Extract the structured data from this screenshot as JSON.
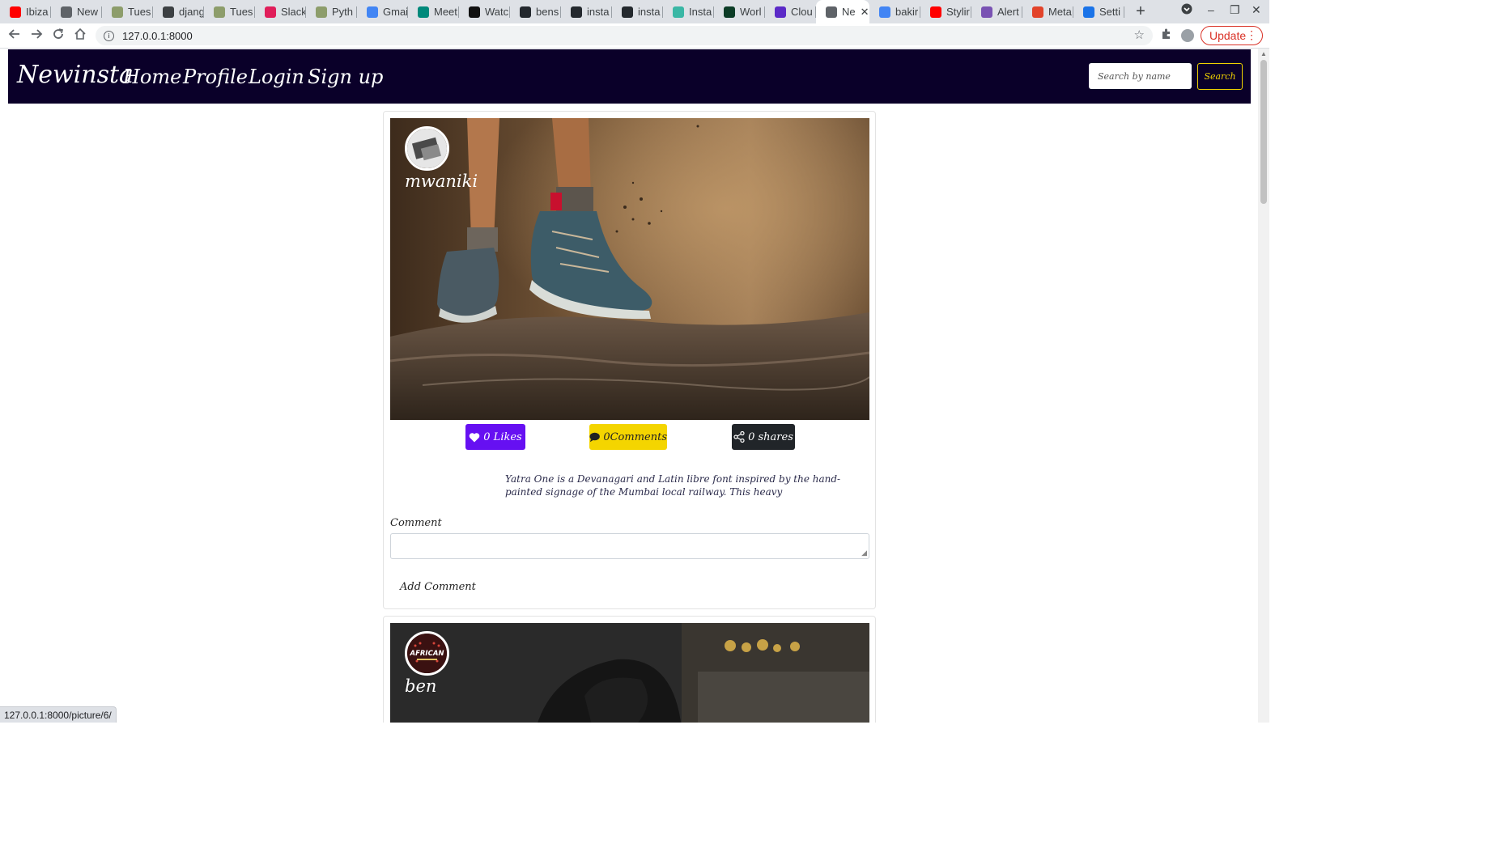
{
  "browser": {
    "tabs": [
      {
        "label": "Ibiza",
        "icon": "youtube-icon",
        "color": "#ff0000"
      },
      {
        "label": "New",
        "icon": "globe-icon",
        "color": "#5f6368"
      },
      {
        "label": "Tues",
        "icon": "tree-icon",
        "color": "#8d9d6b"
      },
      {
        "label": "djang",
        "icon": "doc-icon",
        "color": "#3c4043"
      },
      {
        "label": "Tues",
        "icon": "tree-icon",
        "color": "#8d9d6b"
      },
      {
        "label": "Slack",
        "icon": "slack-icon",
        "color": "#e01e5a"
      },
      {
        "label": "Pyth",
        "icon": "tree-icon",
        "color": "#8d9d6b"
      },
      {
        "label": "Gmai",
        "icon": "google-icon",
        "color": "#4285f4"
      },
      {
        "label": "Meet",
        "icon": "meet-icon",
        "color": "#00897b"
      },
      {
        "label": "Watc",
        "icon": "s-icon",
        "color": "#111111"
      },
      {
        "label": "bens",
        "icon": "github-icon",
        "color": "#24292e"
      },
      {
        "label": "insta",
        "icon": "github-icon",
        "color": "#24292e"
      },
      {
        "label": "insta",
        "icon": "github-icon",
        "color": "#24292e"
      },
      {
        "label": "Insta",
        "icon": "x-icon",
        "color": "#3ab7a5"
      },
      {
        "label": "Worl",
        "icon": "django-icon",
        "color": "#0c3c26"
      },
      {
        "label": "Clou",
        "icon": "cloud-icon",
        "color": "#5b2ac7"
      },
      {
        "label": "Ne",
        "icon": "globe-icon",
        "color": "#5f6368",
        "active": true
      },
      {
        "label": "bakir",
        "icon": "google-icon",
        "color": "#4285f4"
      },
      {
        "label": "Stylir",
        "icon": "youtube-icon",
        "color": "#ff0000"
      },
      {
        "label": "Alert",
        "icon": "bootstrap-icon",
        "color": "#7952b3"
      },
      {
        "label": "Meta",
        "icon": "meta-icon",
        "color": "#e2432a"
      },
      {
        "label": "Setti",
        "icon": "gear-icon",
        "color": "#1a73e8"
      }
    ],
    "url": "127.0.0.1:8000",
    "update_label": "Update",
    "status_url": "127.0.0.1:8000/picture/6/"
  },
  "site": {
    "brand": "Newinsta",
    "links": [
      "Home",
      "Profile",
      "Login",
      "Sign up"
    ],
    "search_placeholder": "Search by name",
    "search_button": "Search"
  },
  "posts": [
    {
      "username": "mwaniki",
      "likes": "0 Likes",
      "comments": "0Comments",
      "shares": "0 shares",
      "caption": "Yatra One is a Devanagari and Latin libre font inspired by the hand-painted signage of the Mumbai local railway. This heavy",
      "comment_label": "Comment",
      "add_comment": "Add Comment"
    },
    {
      "username": "ben",
      "avatar_text": "AFRICAN"
    }
  ]
}
